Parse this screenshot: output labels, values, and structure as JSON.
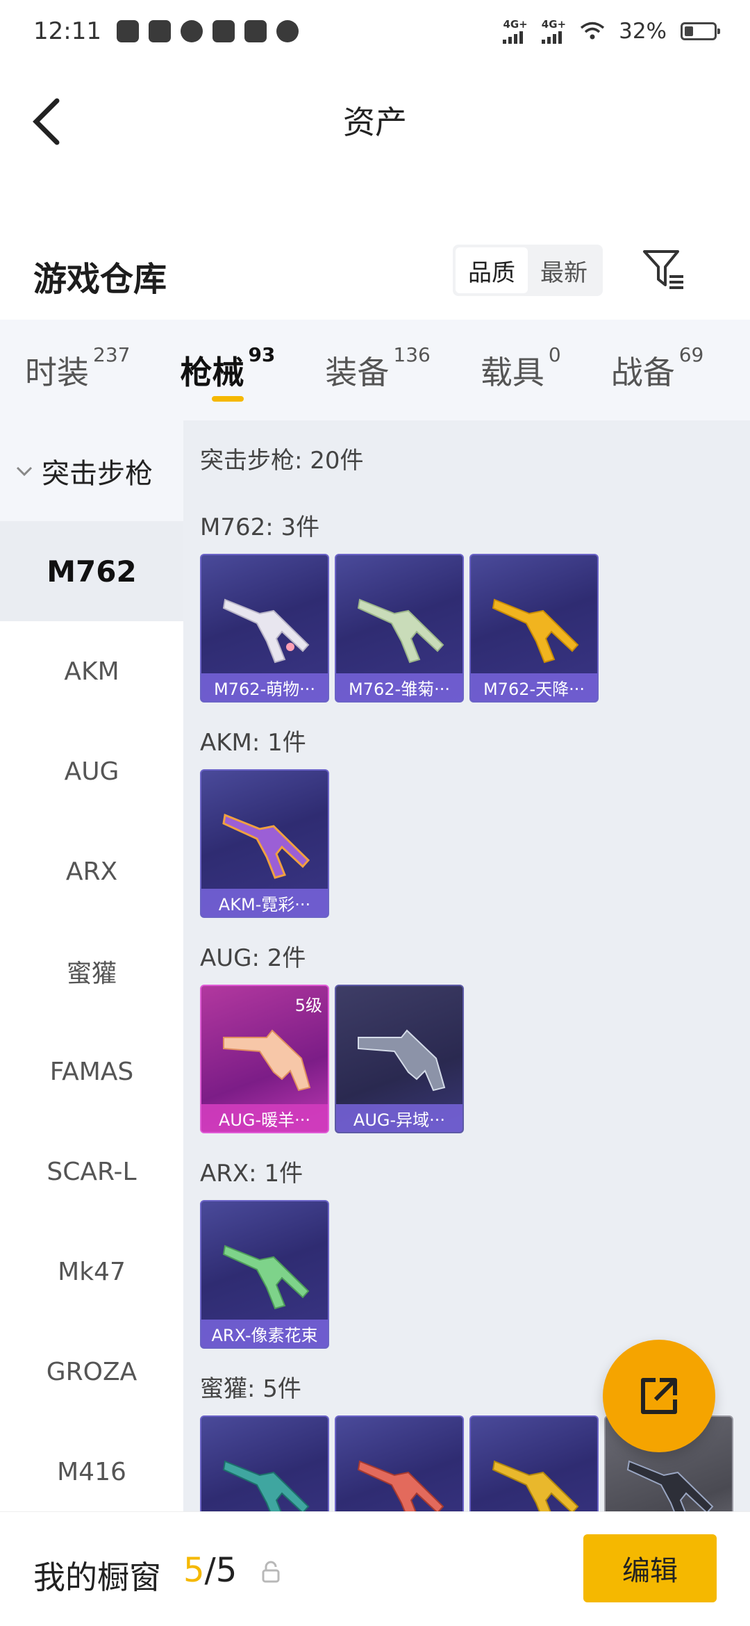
{
  "status_bar": {
    "time": "12:11",
    "signal1": "4G+",
    "signal2": "4G+",
    "battery": "32%"
  },
  "header": {
    "title": "资产"
  },
  "warehouse": {
    "title": "游戏仓库",
    "sort_options": [
      "品质",
      "最新"
    ],
    "sort_selected": "品质"
  },
  "tabs": [
    {
      "label": "时装",
      "count": "237"
    },
    {
      "label": "枪械",
      "count": "93"
    },
    {
      "label": "装备",
      "count": "136"
    },
    {
      "label": "载具",
      "count": "0"
    },
    {
      "label": "战备",
      "count": "69"
    }
  ],
  "sidebar": {
    "category": "突击步枪",
    "items": [
      "M762",
      "AKM",
      "AUG",
      "ARX",
      "蜜獾",
      "FAMAS",
      "SCAR-L",
      "Mk47",
      "GROZA",
      "M416"
    ],
    "active": "M762"
  },
  "content": {
    "summary": "突击步枪: 20件",
    "groups": [
      {
        "label": "M762: 3件",
        "items": [
          "M762-萌物···",
          "M762-雏菊···",
          "M762-天降···"
        ]
      },
      {
        "label": "AKM: 1件",
        "items": [
          "AKM-霓彩···"
        ]
      },
      {
        "label": "AUG: 2件",
        "items": [
          "AUG-暖羊···",
          "AUG-异域···"
        ],
        "badge": "5级"
      },
      {
        "label": "ARX: 1件",
        "items": [
          "ARX-像素花束"
        ]
      },
      {
        "label": "蜜獾: 5件"
      }
    ]
  },
  "bottom": {
    "label": "我的橱窗",
    "current": "5",
    "sep": "/",
    "total": "5",
    "edit_label": "编辑"
  },
  "colors": {
    "accent": "#f5b800",
    "fab": "#f5a400",
    "card_purple": "#2f2c72",
    "card_pink": "#7c1d87"
  },
  "icons": [
    "back-icon",
    "filter-icon",
    "chevron-down-icon",
    "lock-icon",
    "share-icon"
  ]
}
